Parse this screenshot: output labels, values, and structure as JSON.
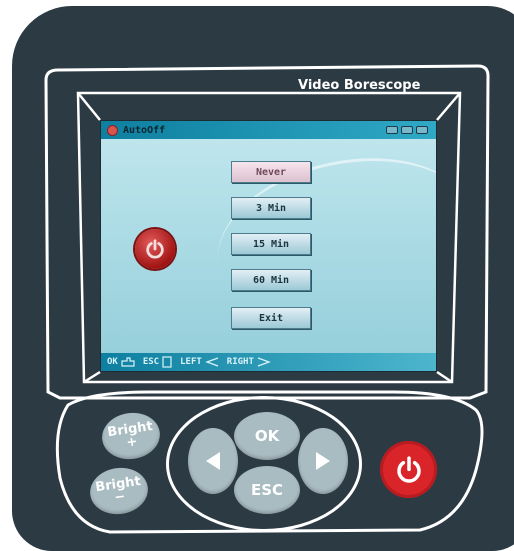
{
  "device": {
    "brand_label": "Video Borescope"
  },
  "screen": {
    "title": "AutoOff",
    "menu": {
      "items": [
        "Never",
        "3 Min",
        "15 Min",
        "60 Min",
        "Exit"
      ],
      "selected": "Never"
    },
    "footer": {
      "ok": "OK",
      "esc": "ESC",
      "left": "LEFT",
      "right": "RIGHT"
    }
  },
  "keypad": {
    "bright_plus": "Bright",
    "bright_plus_sign": "+",
    "bright_minus": "Bright",
    "bright_minus_sign": "−",
    "ok": "OK",
    "esc": "ESC",
    "left_icon": "triangle-left-icon",
    "right_icon": "triangle-right-icon",
    "power_icon": "power-icon"
  },
  "colors": {
    "body": "#2c3a44",
    "screen_bar": "#0e7fa0",
    "power_button": "#d9252a",
    "key": "#a9bcc2"
  }
}
